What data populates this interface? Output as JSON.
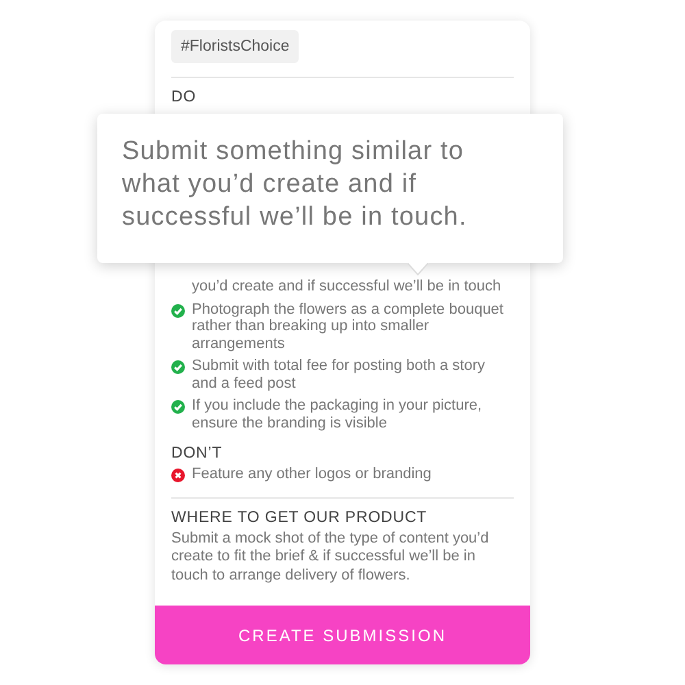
{
  "tag": "#FloristsChoice",
  "do_heading": "DO",
  "tooltip": "Submit something similar to what you’d create and if successful we’ll be in touch.",
  "do_items": [
    {
      "text": "you’d create and if successful we’ll be in touch",
      "icon_visible": false
    },
    {
      "text": "Photograph the flowers as a complete bouquet rather than breaking up into smaller arrangements",
      "icon_visible": true
    },
    {
      "text": "Submit with total fee for posting both a story and a feed post",
      "icon_visible": true
    },
    {
      "text": "If you include the packaging in your picture, ensure the branding is visible",
      "icon_visible": true
    }
  ],
  "dont_heading": "DON’T",
  "dont_items": [
    {
      "text": "Feature any other logos or branding",
      "icon_visible": true
    }
  ],
  "product_heading": "WHERE TO GET OUR PRODUCT",
  "product_text": "Submit a mock shot of the type of content you’d create to fit the brief & if successful we’ll be in touch to arrange delivery of flowers.",
  "button": "CREATE SUBMISSION"
}
